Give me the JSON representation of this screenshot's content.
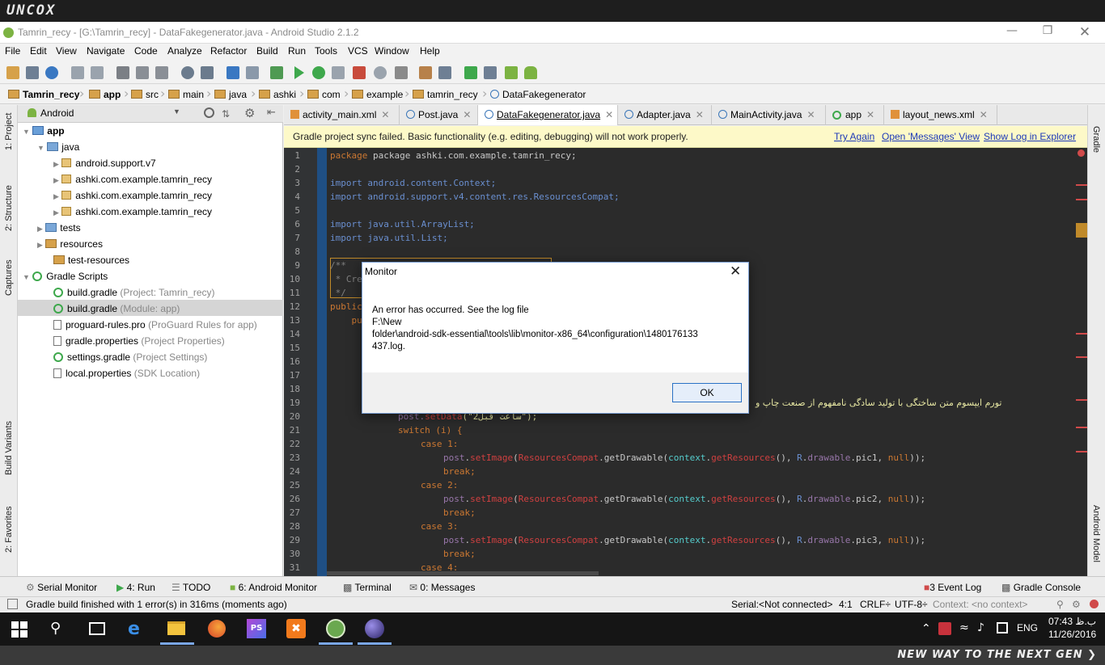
{
  "brand": {
    "logo": "uncox"
  },
  "window": {
    "title": "Tamrin_recy - [G:\\Tamrin_recy] - DataFakegenerator.java - Android Studio 2.1.2"
  },
  "menu": [
    "File",
    "Edit",
    "View",
    "Navigate",
    "Code",
    "Analyze",
    "Refactor",
    "Build",
    "Run",
    "Tools",
    "VCS",
    "Window",
    "Help"
  ],
  "breadcrumb": [
    "Tamrin_recy",
    "app",
    "src",
    "main",
    "java",
    "ashki",
    "com",
    "example",
    "tamrin_recy",
    "DataFakegenerator"
  ],
  "project_panel": {
    "view": "Android",
    "tree": [
      {
        "label": "app",
        "extra": ""
      },
      {
        "label": "java",
        "extra": ""
      },
      {
        "label": "android.support.v7",
        "extra": ""
      },
      {
        "label": "ashki.com.example.tamrin_recy",
        "extra": ""
      },
      {
        "label": "ashki.com.example.tamrin_recy",
        "extra": ""
      },
      {
        "label": "ashki.com.example.tamrin_recy",
        "extra": ""
      },
      {
        "label": "tests",
        "extra": ""
      },
      {
        "label": "resources",
        "extra": ""
      },
      {
        "label": "test-resources",
        "extra": ""
      },
      {
        "label": "Gradle Scripts",
        "extra": ""
      },
      {
        "label": "build.gradle",
        "extra": "(Project: Tamrin_recy)"
      },
      {
        "label": "build.gradle",
        "extra": "(Module: app)"
      },
      {
        "label": "proguard-rules.pro",
        "extra": "(ProGuard Rules for app)"
      },
      {
        "label": "gradle.properties",
        "extra": "(Project Properties)"
      },
      {
        "label": "settings.gradle",
        "extra": "(Project Settings)"
      },
      {
        "label": "local.properties",
        "extra": "(SDK Location)"
      }
    ]
  },
  "left_tabs": {
    "project": "1: Project",
    "structure": "2: Structure",
    "captures": "Captures",
    "build_variants": "Build Variants",
    "favorites": "2: Favorites"
  },
  "right_tabs": {
    "gradle": "Gradle",
    "android_model": "Android Model"
  },
  "tabs": [
    {
      "label": "activity_main.xml"
    },
    {
      "label": "Post.java"
    },
    {
      "label": "DataFakegenerator.java"
    },
    {
      "label": "Adapter.java"
    },
    {
      "label": "MainActivity.java"
    },
    {
      "label": "app"
    },
    {
      "label": "layout_news.xml"
    }
  ],
  "banner": {
    "text": "Gradle project sync failed. Basic functionality (e.g. editing, debugging) will not work properly.",
    "try_again": "Try Again",
    "open_messages": "Open 'Messages' View",
    "show_log": "Show Log in Explorer"
  },
  "code": {
    "line_numbers": [
      "1",
      "2",
      "3",
      "4",
      "5",
      "6",
      "7",
      "8",
      "9",
      "10",
      "11",
      "12",
      "13",
      "14",
      "15",
      "16",
      "17",
      "18",
      "19",
      "20",
      "21",
      "22",
      "23",
      "24",
      "25",
      "26",
      "27",
      "28",
      "29",
      "30",
      "31"
    ],
    "l1": "package ashki.com.example.tamrin_recy;",
    "l3": "import android.content.Context;",
    "l4": "import android.support.v4.content.res.ResourcesCompat;",
    "l6": "import java.util.ArrayList;",
    "l7": "import java.util.List;",
    "l9": "/**",
    "l10": " * Cre",
    "l11": " */",
    "l12": "public",
    "l13": "    pu",
    "l19_rtl": "تورم ایپسوم متن ساختگی با تولید سادگی نامفهوم از صنعت چاپ و",
    "l20a": "post.",
    "l20b": "setData",
    "l20c": "(\"2ساعت قبل\");",
    "l21": "switch (i) {",
    "case1": "case 1:",
    "case2": "case 2:",
    "case3": "case 3:",
    "case4": "case 4:",
    "break": "break;",
    "pic1": "pic1",
    "pic2": "pic2",
    "pic3": "pic3"
  },
  "dialog": {
    "title": "Monitor",
    "line1": "An error has occurred. See the log file",
    "line2": "F:\\New",
    "line3": "folder\\android-sdk-essential\\tools\\lib\\monitor-x86_64\\configuration\\1480176133",
    "line4": "437.log.",
    "ok": "OK"
  },
  "bottom_tabs": {
    "serial": "Serial Monitor",
    "run": "4: Run",
    "todo": "TODO",
    "android_monitor": "6: Android Monitor",
    "terminal": "Terminal",
    "messages": "0: Messages",
    "event_log": "3 Event Log",
    "gradle_console": "Gradle Console"
  },
  "status": {
    "message": "Gradle build finished with 1 error(s) in 316ms (moments ago)",
    "serial": "Serial:<Not connected>",
    "position": "4:1",
    "line_sep": "CRLF÷",
    "encoding": "UTF-8÷",
    "context": "Context: <no context>"
  },
  "taskbar": {
    "lang": "ENG",
    "time": "07:43 ب.ظ",
    "date": "11/26/2016"
  },
  "footer": {
    "tagline": "NEW WAY TO THE NEXT GEN ❯"
  }
}
